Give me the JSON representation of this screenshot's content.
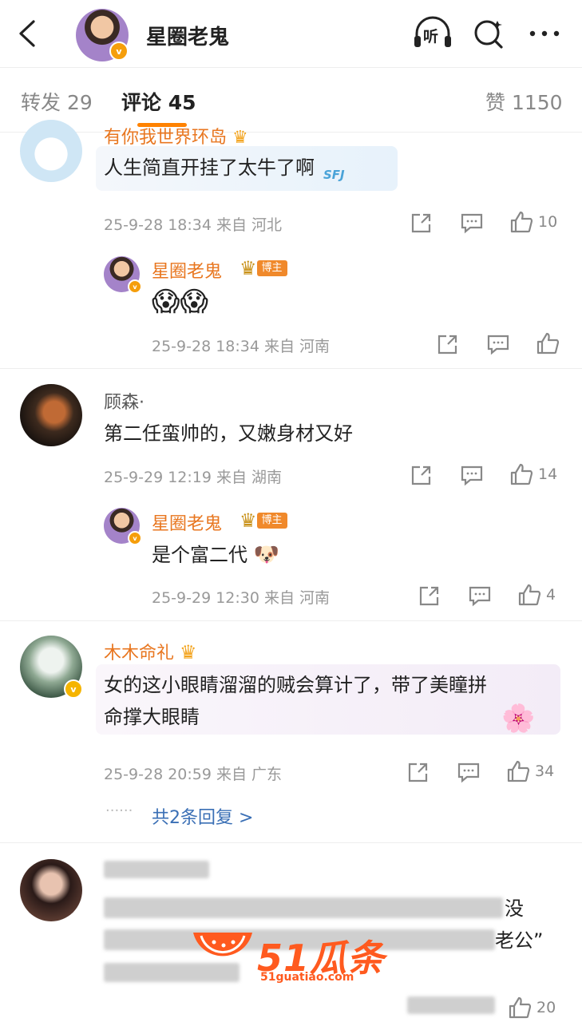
{
  "header": {
    "title": "星圈老鬼",
    "listen_label": "听",
    "verified": "v"
  },
  "tabs": [
    {
      "label": "转发",
      "count": "29"
    },
    {
      "label": "评论",
      "count": "45"
    },
    {
      "label": "赞",
      "count": "1150"
    }
  ],
  "comments": [
    {
      "user": "有你我世界环岛",
      "text": "人生简直开挂了太牛了啊",
      "time": "25-9-28 18:34 来自 河北",
      "likes": "10",
      "sticker": "SFJ",
      "reply": {
        "user": "星圈老鬼",
        "badge": "博主",
        "text": "😱😱",
        "time": "25-9-28 18:34 来自 河南",
        "likes": ""
      }
    },
    {
      "user": "顾森·",
      "text": "第二任蛮帅的，又嫩身材又好",
      "time": "25-9-29 12:19 来自 湖南",
      "likes": "14",
      "reply": {
        "user": "星圈老鬼",
        "badge": "博主",
        "text": "是个富二代",
        "time": "25-9-29 12:30 来自 河南",
        "likes": "4"
      }
    },
    {
      "user": "木木命礼",
      "text_line1": "女的这小眼睛溜溜的贼会算计了，带了美瞳拼",
      "text_line2": "命撑大眼睛",
      "time": "25-9-28 20:59 来自 广东",
      "likes": "34",
      "more_replies": "共2条回复 >",
      "dots": "······"
    },
    {
      "partial1": "没",
      "partial2": "老公”",
      "likes": "20"
    }
  ],
  "watermark": {
    "main": "51瓜条",
    "sub": "51guatiao.com"
  },
  "colors": {
    "accent": "#ff8200",
    "username": "#e8761f",
    "muted": "#999999",
    "link": "#3a6fb5"
  }
}
